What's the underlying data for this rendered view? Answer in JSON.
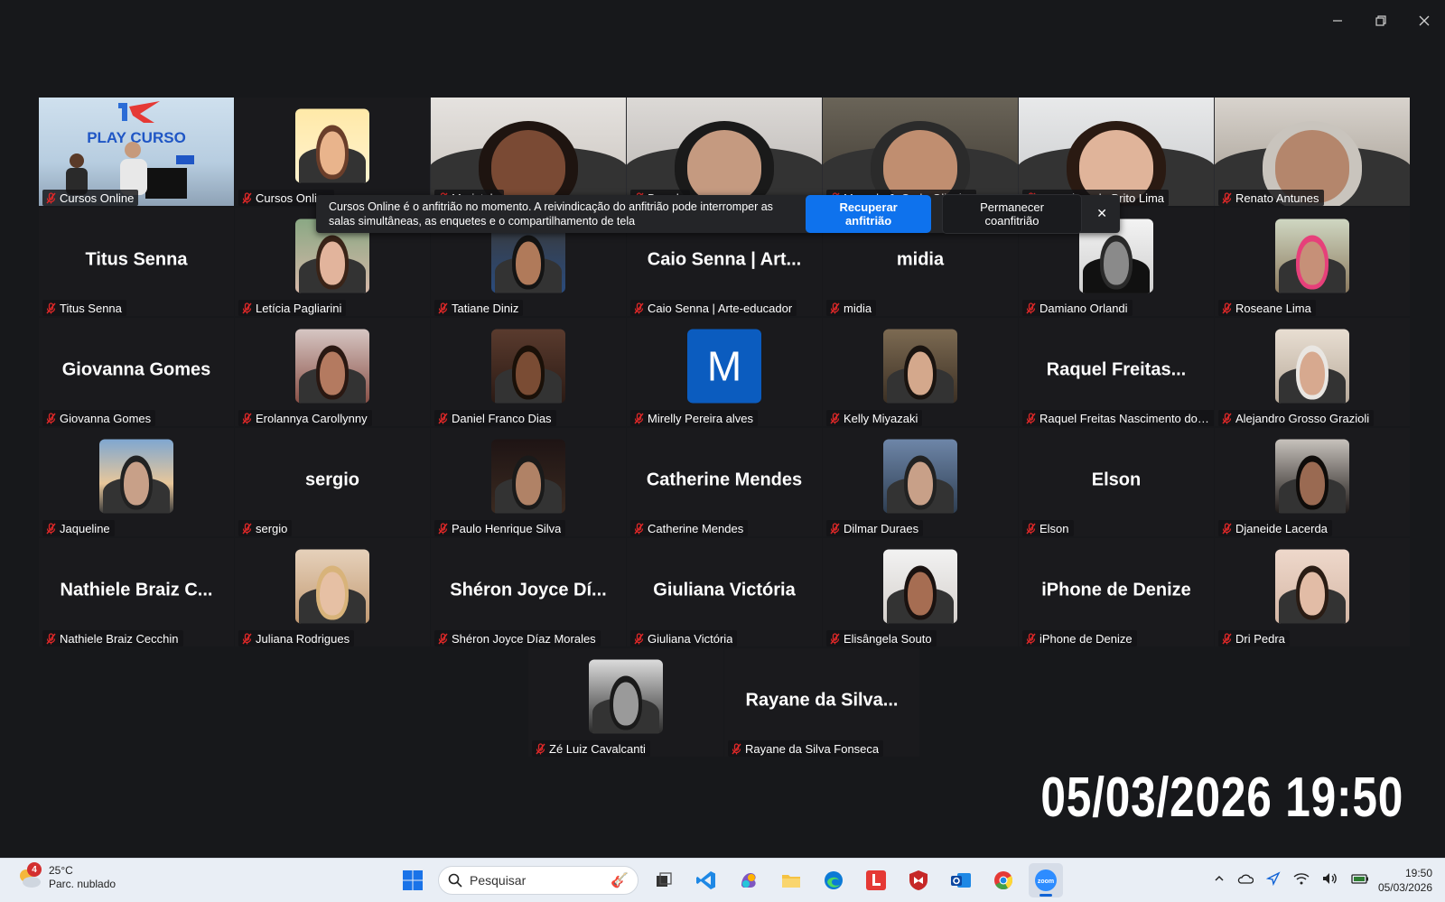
{
  "window": {
    "minimize": "—",
    "restore": "❐",
    "close": "✕"
  },
  "participants": [
    {
      "name": "Cursos Online",
      "display": "video",
      "theme": "playcurso",
      "highlight": true,
      "overlay_text": "PLAY CURSO"
    },
    {
      "name": "Cursos Online",
      "display": "avatar",
      "theme": "illustration"
    },
    {
      "name": "Maristela",
      "display": "video",
      "theme": "woman-glasses",
      "strip": true
    },
    {
      "name": "Brenda",
      "display": "video",
      "theme": "girl-glasses",
      "strip": true
    },
    {
      "name": "Marcelo J. C. de Oliveira",
      "display": "video",
      "theme": "man-shop",
      "strip": true
    },
    {
      "name": "Ana Clara de Brito Lima",
      "display": "video",
      "theme": "young-woman",
      "strip": true
    },
    {
      "name": "Renato Antunes",
      "display": "video",
      "theme": "older-man",
      "strip": true
    },
    {
      "name": "Titus Senna",
      "display": "text",
      "big": "Titus Senna"
    },
    {
      "name": "Letícia Pagliarini",
      "display": "avatar",
      "theme": "two-women"
    },
    {
      "name": "Tatiane Diniz",
      "display": "avatar",
      "theme": "woman-glasses-dark"
    },
    {
      "name": "Caio Senna | Arte-educador",
      "display": "text",
      "big": "Caio Senna | Art..."
    },
    {
      "name": "midia",
      "display": "text",
      "big": "midia"
    },
    {
      "name": "Damiano Orlandi",
      "display": "avatar",
      "theme": "bw-man"
    },
    {
      "name": "Roseane Lima",
      "display": "avatar",
      "theme": "pink-cap"
    },
    {
      "name": "Giovanna Gomes",
      "display": "text",
      "big": "Giovanna Gomes"
    },
    {
      "name": "Erolannya Carollynny",
      "display": "avatar",
      "theme": "smiling-woman"
    },
    {
      "name": "Daniel Franco Dias",
      "display": "avatar",
      "theme": "man-face"
    },
    {
      "name": "Mirelly Pereira alves",
      "display": "letter",
      "letter": "M"
    },
    {
      "name": "Kelly Miyazaki",
      "display": "avatar",
      "theme": "woman-restaurant"
    },
    {
      "name": "Raquel Freitas Nascimento dos ...",
      "display": "text",
      "big": "Raquel  Freitas..."
    },
    {
      "name": "Alejandro Grosso Grazioli",
      "display": "avatar",
      "theme": "elderly-man"
    },
    {
      "name": "Jaqueline",
      "display": "avatar",
      "theme": "sunset"
    },
    {
      "name": "sergio",
      "display": "text",
      "big": "sergio"
    },
    {
      "name": "Paulo Henrique Silva",
      "display": "avatar",
      "theme": "stage-man"
    },
    {
      "name": "Catherine Mendes",
      "display": "text",
      "big": "Catherine Mendes"
    },
    {
      "name": "Dilmar Duraes",
      "display": "avatar",
      "theme": "group"
    },
    {
      "name": "Elson",
      "display": "text",
      "big": "Elson"
    },
    {
      "name": "Djaneide Lacerda",
      "display": "avatar",
      "theme": "woman-dark-hair"
    },
    {
      "name": "Nathiele Braiz Cecchin",
      "display": "text",
      "big": "Nathiele  Braiz  C..."
    },
    {
      "name": "Juliana Rodrigues",
      "display": "avatar",
      "theme": "blonde-selfie"
    },
    {
      "name": "Shéron Joyce Díaz Morales",
      "display": "text",
      "big": "Shéron  Joyce  Dí..."
    },
    {
      "name": "Giuliana Victória",
      "display": "text",
      "big": "Giuliana Victória"
    },
    {
      "name": "Elisângela Souto",
      "display": "avatar",
      "theme": "woman-portrait"
    },
    {
      "name": "iPhone de Denize",
      "display": "text",
      "big": "iPhone de Denize"
    },
    {
      "name": "Dri Pedra",
      "display": "avatar",
      "theme": "woman-eyes"
    },
    {
      "name": "Zé Luiz Cavalcanti",
      "display": "avatar",
      "theme": "camera-man"
    },
    {
      "name": "Rayane da Silva Fonseca",
      "display": "text",
      "big": "Rayane  da  Silva..."
    }
  ],
  "notification": {
    "message": "Cursos Online é o anfitrião no momento. A reivindicação do anfitrião pode interromper as salas simultâneas, as enquetes e o compartilhamento de tela",
    "primary_button": "Recuperar anfitrião",
    "secondary_button": "Permanecer coanfitrião",
    "close": "✕"
  },
  "overlay_datetime": "05/03/2026 19:50",
  "taskbar": {
    "weather_temp": "25°C",
    "weather_desc": "Parc. nublado",
    "weather_badge": "4",
    "search_placeholder": "Pesquisar",
    "clock_time": "19:50",
    "clock_date": "05/03/2026"
  }
}
